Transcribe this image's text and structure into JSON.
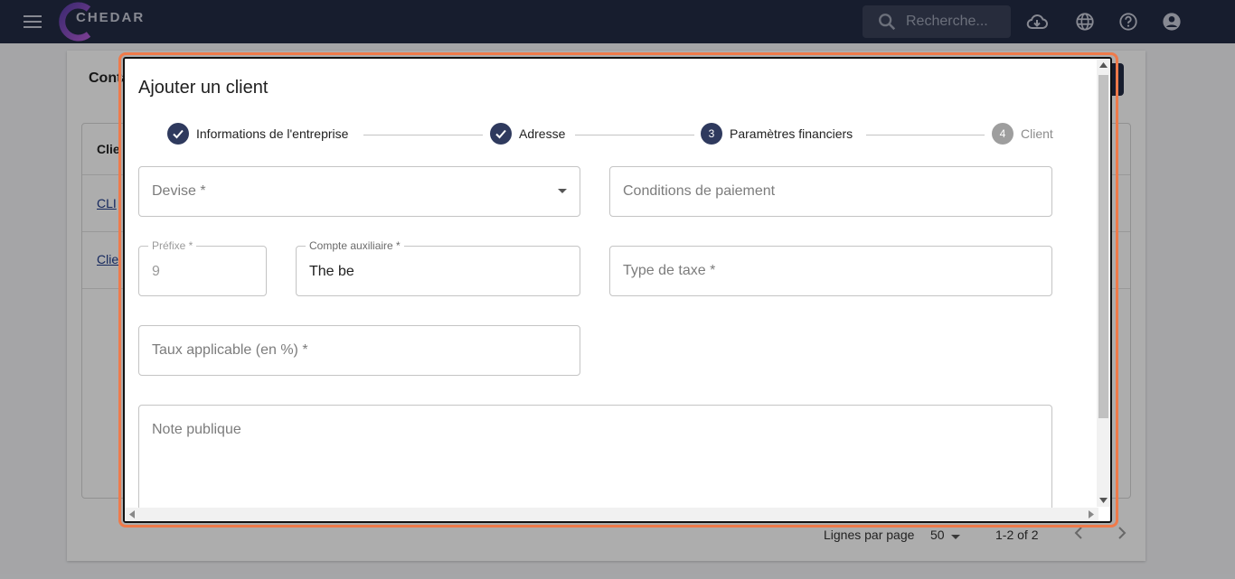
{
  "appbar": {
    "logo_text": "CHEDAR",
    "search_placeholder": "Recherche...",
    "icons": [
      "menu-icon",
      "cloud-download-icon",
      "globe-icon",
      "help-icon",
      "account-icon"
    ]
  },
  "background": {
    "title": "Conta",
    "column_header": "Clie",
    "rows": [
      "CLI",
      "Clie"
    ],
    "footer": {
      "rows_per_page_label": "Lignes par page",
      "rows_per_page_value": "50",
      "range": "1-2 of 2"
    }
  },
  "dialog": {
    "title": "Ajouter un client",
    "steps": [
      {
        "label": "Informations de l'entreprise",
        "state": "done",
        "number": ""
      },
      {
        "label": "Adresse",
        "state": "done",
        "number": ""
      },
      {
        "label": "Paramètres financiers",
        "state": "active",
        "number": "3"
      },
      {
        "label": "Client",
        "state": "todo",
        "number": "4"
      }
    ],
    "fields": {
      "devise": {
        "placeholder": "Devise *"
      },
      "conditions": {
        "placeholder": "Conditions de paiement"
      },
      "prefixe": {
        "label": "Préfixe *",
        "value": "9"
      },
      "compte": {
        "label": "Compte auxiliaire *",
        "value": "The be"
      },
      "type_taxe": {
        "placeholder": "Type de taxe *"
      },
      "taux": {
        "placeholder": "Taux applicable (en %) *"
      },
      "note": {
        "placeholder": "Note publique"
      }
    }
  },
  "colors": {
    "appbar": "#232c45",
    "step_active": "#2f3a5e",
    "step_todo": "#9e9e9e",
    "dialog_outline": "#ef7a4a"
  }
}
